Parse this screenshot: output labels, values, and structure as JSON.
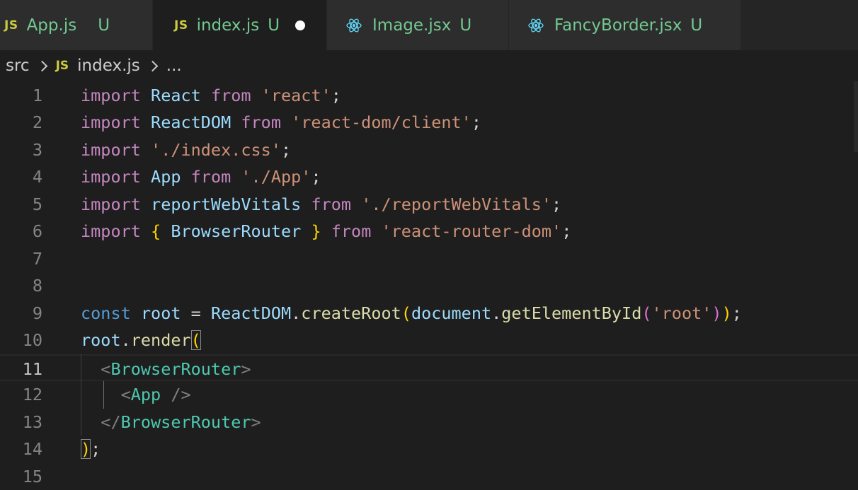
{
  "tabs": [
    {
      "icon": "js-icon",
      "badge": "JS",
      "label": "App.js",
      "status": "U",
      "active": false
    },
    {
      "icon": "js-icon",
      "badge": "JS",
      "label": "index.js",
      "status": "U",
      "active": true,
      "dirty": true
    },
    {
      "icon": "react-icon",
      "label": "Image.jsx",
      "status": "U",
      "active": false
    },
    {
      "icon": "react-icon",
      "label": "FancyBorder.jsx",
      "status": "U",
      "active": false
    }
  ],
  "breadcrumb": {
    "folder": "src",
    "file_badge": "JS",
    "file": "index.js",
    "more": "..."
  },
  "editor": {
    "current_line": 11,
    "line_numbers": [
      "1",
      "2",
      "3",
      "4",
      "5",
      "6",
      "7",
      "8",
      "9",
      "10",
      "11",
      "12",
      "13",
      "14",
      "15"
    ],
    "lines": [
      "import React from 'react';",
      "import ReactDOM from 'react-dom/client';",
      "import './index.css';",
      "import App from './App';",
      "import reportWebVitals from './reportWebVitals';",
      "import { BrowserRouter } from 'react-router-dom';",
      "",
      "",
      "const root = ReactDOM.createRoot(document.getElementById('root'));",
      "root.render(",
      "  <BrowserRouter>",
      "    <App />",
      "  </BrowserRouter>",
      ");",
      ""
    ]
  },
  "colors": {
    "background": "#1e1e1e",
    "tab_inactive": "#2d2d2d",
    "keyword": "#c586c0",
    "string": "#ce9178",
    "variable": "#9cdcfe",
    "function": "#dcdcaa",
    "tag": "#4ec9b0",
    "untracked": "#73c991",
    "js_badge": "#cbcb41"
  }
}
